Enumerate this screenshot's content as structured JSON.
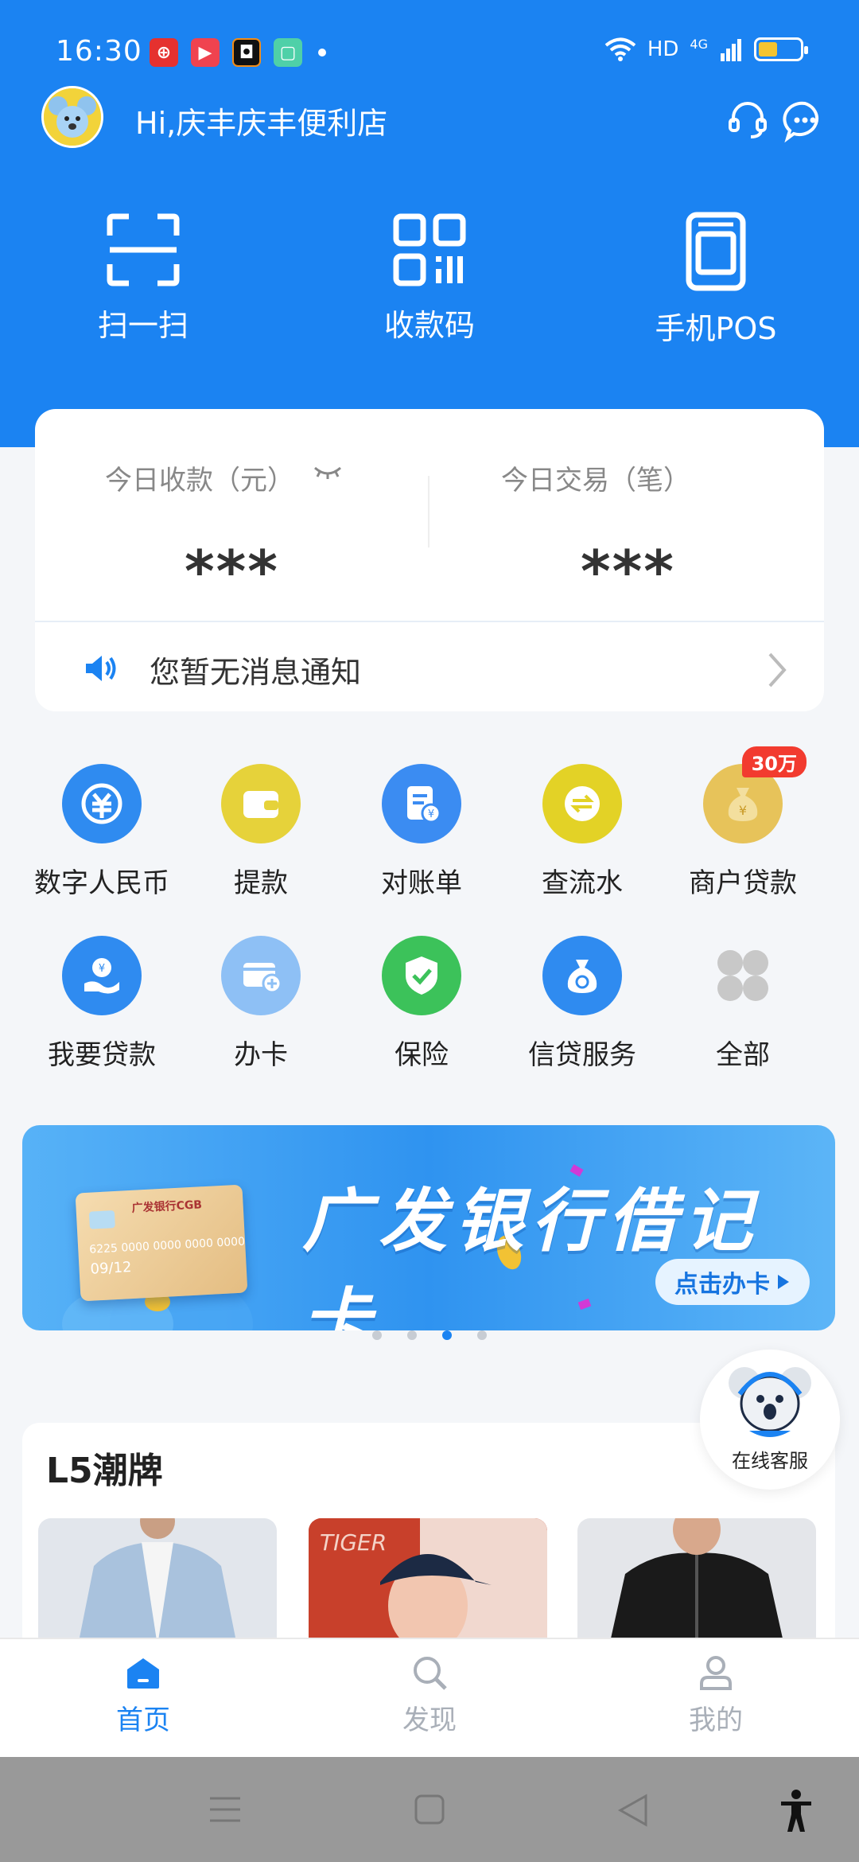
{
  "status_bar": {
    "time": "16:30",
    "network": "HD",
    "signal": "4G",
    "battery_level": 0.45,
    "battery_color": "#f4c430"
  },
  "header": {
    "greeting": "Hi,庆丰庆丰便利店",
    "icons": [
      "customer-service-icon",
      "message-icon"
    ]
  },
  "quick_actions": [
    {
      "label": "扫一扫",
      "icon": "scan-icon"
    },
    {
      "label": "收款码",
      "icon": "qr-code-icon"
    },
    {
      "label": "手机POS",
      "icon": "pos-terminal-icon"
    }
  ],
  "summary": {
    "receipts_label": "今日收款（元）",
    "receipts_value": "***",
    "transactions_label": "今日交易（笔）",
    "transactions_value": "***",
    "notice": "您暂无消息通知"
  },
  "services": [
    {
      "label": "数字人民币",
      "icon": "digital-rmb-icon",
      "color": "#2f8bf0"
    },
    {
      "label": "提款",
      "icon": "wallet-icon",
      "color": "#e6d23a"
    },
    {
      "label": "对账单",
      "icon": "statement-icon",
      "color": "#3b8cf2"
    },
    {
      "label": "查流水",
      "icon": "transfer-icon",
      "color": "#e3d226"
    },
    {
      "label": "商户贷款",
      "icon": "money-bag-icon",
      "color": "#e7c35a",
      "badge": "30万"
    },
    {
      "label": "我要贷款",
      "icon": "loan-hand-icon",
      "color": "#2f8bf0"
    },
    {
      "label": "办卡",
      "icon": "card-add-icon",
      "color": "#8ec0f5"
    },
    {
      "label": "保险",
      "icon": "shield-check-icon",
      "color": "#3cc25a"
    },
    {
      "label": "信贷服务",
      "icon": "credit-bag-icon",
      "color": "#2f8bf0"
    },
    {
      "label": "全部",
      "icon": "all-grid-icon",
      "color": "#c8c8c8"
    }
  ],
  "banner": {
    "title": "广发银行借记卡",
    "cta": "点击办卡",
    "card_bank": "广发银行CGB",
    "card_number": "6225 0000 0000 0000 0000",
    "card_date": "09/12",
    "active_index": 2,
    "total": 4
  },
  "products": {
    "title": "L5潮牌"
  },
  "customer_service": {
    "label": "在线客服"
  },
  "bottom_nav": [
    {
      "label": "首页",
      "icon": "home-icon",
      "active": true
    },
    {
      "label": "发现",
      "icon": "discover-icon",
      "active": false
    },
    {
      "label": "我的",
      "icon": "profile-icon",
      "active": false
    }
  ],
  "colors": {
    "brand_blue": "#1b83f2",
    "badge_red": "#f23b2f"
  }
}
